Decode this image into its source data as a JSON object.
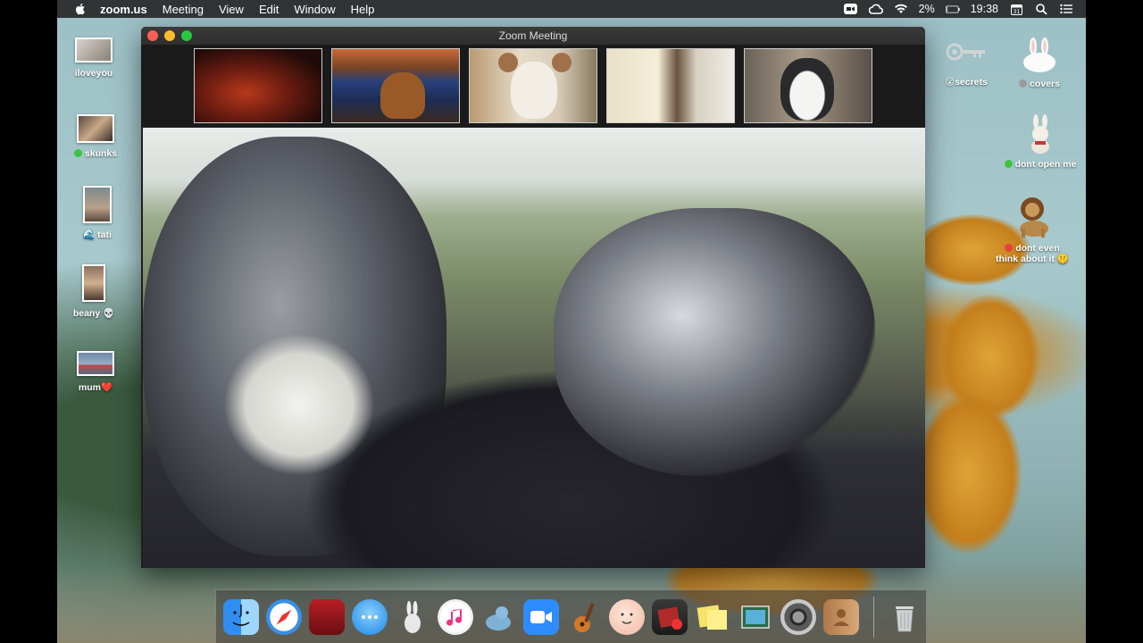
{
  "menubar": {
    "app_name": "zoom.us",
    "menus": [
      "Meeting",
      "View",
      "Edit",
      "Window",
      "Help"
    ],
    "battery": "2%",
    "time": "19:38"
  },
  "window": {
    "title": "Zoom Meeting"
  },
  "desktop_left": [
    {
      "label": "iloveyou"
    },
    {
      "label": "skunks",
      "tag": "green"
    },
    {
      "label": "tati",
      "prefix_emoji": "🌊"
    },
    {
      "label": "beany 💀"
    },
    {
      "label": "mum❤️"
    }
  ],
  "desktop_right": [
    {
      "label": "secrets",
      "prefix_emoji": "😮"
    },
    {
      "label": "covers",
      "tag": "gray"
    },
    {
      "label": "dont open me",
      "tag": "green"
    },
    {
      "label_line1": "dont even",
      "label_line2": "think about it 🤫",
      "tag": "red"
    }
  ],
  "colors": {
    "menubar_bg": "#282828",
    "window_bg": "#1f1f1f",
    "tag_green": "#3cc43c",
    "tag_gray": "#9a9a9a",
    "tag_red": "#e8413a"
  }
}
